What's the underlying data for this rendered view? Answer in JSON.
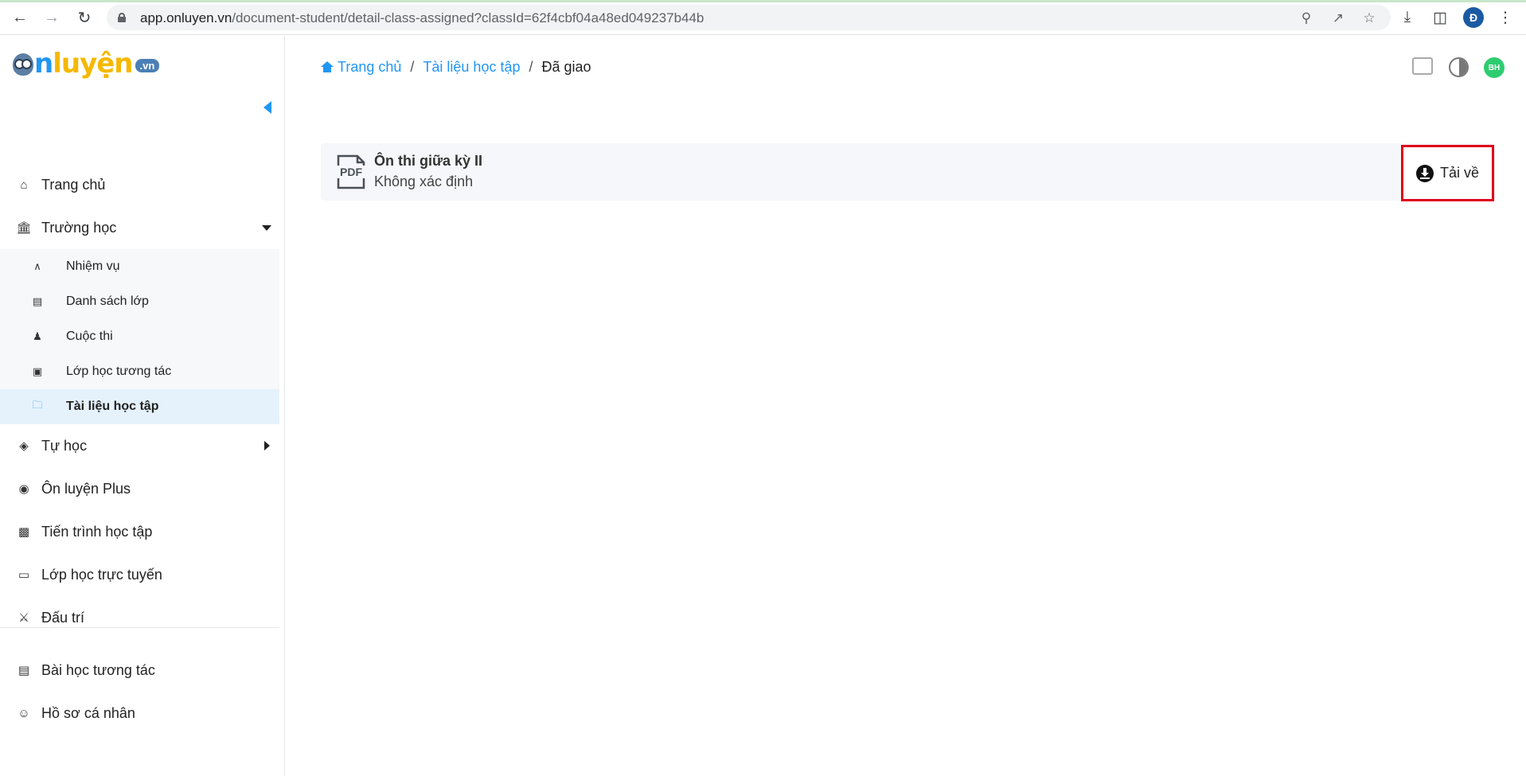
{
  "browser": {
    "url_host": "app.onluyen.vn",
    "url_path": "/document-student/detail-class-assigned?classId=62f4cbf04a48ed049237b44b",
    "profile_initial": "Đ"
  },
  "logo": {
    "part1": "Ôn",
    "part2": "luyện",
    "suffix": ".vn"
  },
  "sidebar": {
    "items": [
      {
        "label": "Trang chủ",
        "icon": "home-icon"
      },
      {
        "label": "Trường học",
        "icon": "school-icon"
      },
      {
        "label": "Tự học",
        "icon": "graduation-cap-icon"
      },
      {
        "label": "Ôn luyện Plus",
        "icon": "owl-icon"
      },
      {
        "label": "Tiến trình học tập",
        "icon": "chart-icon"
      },
      {
        "label": "Lớp học trực tuyến",
        "icon": "monitor-icon"
      },
      {
        "label": "Đấu trí",
        "icon": "battle-icon"
      }
    ],
    "school_sub": [
      {
        "label": "Nhiệm vụ",
        "icon": "compass-icon"
      },
      {
        "label": "Danh sách lớp",
        "icon": "clipboard-icon"
      },
      {
        "label": "Cuộc thi",
        "icon": "contest-icon"
      },
      {
        "label": "Lớp học tương tác",
        "icon": "interactive-class-icon"
      },
      {
        "label": "Tài liệu học tập",
        "icon": "folder-icon"
      }
    ],
    "bottom": [
      {
        "label": "Bài học tương tác",
        "icon": "lesson-icon"
      },
      {
        "label": "Hồ sơ cá nhân",
        "icon": "user-icon"
      }
    ]
  },
  "breadcrumb": {
    "home": "Trang chủ",
    "section": "Tài liệu học tập",
    "current": "Đã giao",
    "separator": "/"
  },
  "header": {
    "avatar_initials": "BH"
  },
  "documents": [
    {
      "title": "Ôn thi giữa kỳ II",
      "subtitle": "Không xác định",
      "type_label": "PDF",
      "action_label": "Tải về"
    }
  ],
  "colors": {
    "accent": "#2196f3",
    "highlight_border": "#e0001b",
    "active_bg": "#e5f2fc"
  }
}
